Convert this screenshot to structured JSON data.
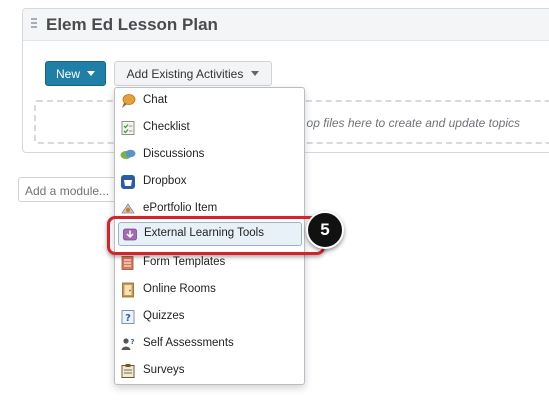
{
  "module": {
    "title": "Elem Ed Lesson Plan",
    "new_label": "New",
    "add_existing_label": "Add Existing Activities",
    "dropzone_text": "op files here to create and update topics",
    "add_module_placeholder": "Add a module..."
  },
  "menu": {
    "items": [
      {
        "label": "Chat",
        "icon": "chat-icon"
      },
      {
        "label": "Checklist",
        "icon": "checklist-icon"
      },
      {
        "label": "Discussions",
        "icon": "discussions-icon"
      },
      {
        "label": "Dropbox",
        "icon": "dropbox-icon"
      },
      {
        "label": "ePortfolio Item",
        "icon": "eportfolio-icon"
      },
      {
        "label": "External Learning Tools",
        "icon": "external-tools-icon",
        "selected": true
      },
      {
        "label": "Form Templates",
        "icon": "form-templates-icon"
      },
      {
        "label": "Online Rooms",
        "icon": "online-rooms-icon"
      },
      {
        "label": "Quizzes",
        "icon": "quizzes-icon"
      },
      {
        "label": "Self Assessments",
        "icon": "self-assessments-icon"
      },
      {
        "label": "Surveys",
        "icon": "surveys-icon"
      }
    ]
  },
  "callout": {
    "step_number": "5",
    "color": "#d3232b"
  },
  "colors": {
    "primary_button": "#1f7fa6",
    "selection_bg": "#e8f1f8"
  }
}
